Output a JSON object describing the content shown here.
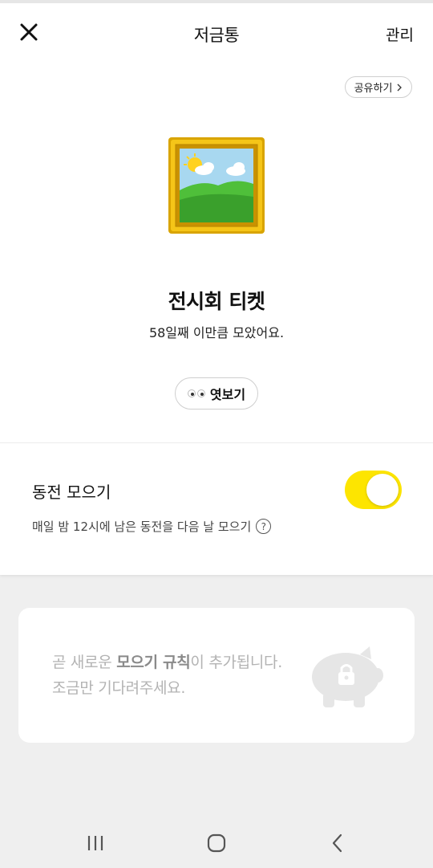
{
  "header": {
    "title": "저금통",
    "manage_label": "관리"
  },
  "share": {
    "label": "공유하기"
  },
  "ticket": {
    "title": "전시회 티켓",
    "subtitle": "58일째 이만큼 모았어요.",
    "peek_label": "엿보기"
  },
  "coin_collect": {
    "label": "동전 모으기",
    "description": "매일 밤 12시에 남은 동전을 다음 날 모으기",
    "help_symbol": "?",
    "toggle_on": true
  },
  "notice": {
    "line1_pre": "곧 새로운 ",
    "line1_bold": "모으기 규칙",
    "line1_post": "이 추가됩니다.",
    "line2": "조금만 기다려주세요."
  },
  "colors": {
    "accent": "#FDE500",
    "background": "#EFEFEF"
  },
  "icons": {
    "close": "close-icon",
    "chevron": "chevron-right-icon",
    "artwork": "framed-picture-icon",
    "eyes": "eyes-icon",
    "help": "question-circle-icon",
    "pig": "piggy-bank-lock-icon",
    "nav": [
      "recent-apps-icon",
      "home-icon",
      "back-icon"
    ]
  }
}
